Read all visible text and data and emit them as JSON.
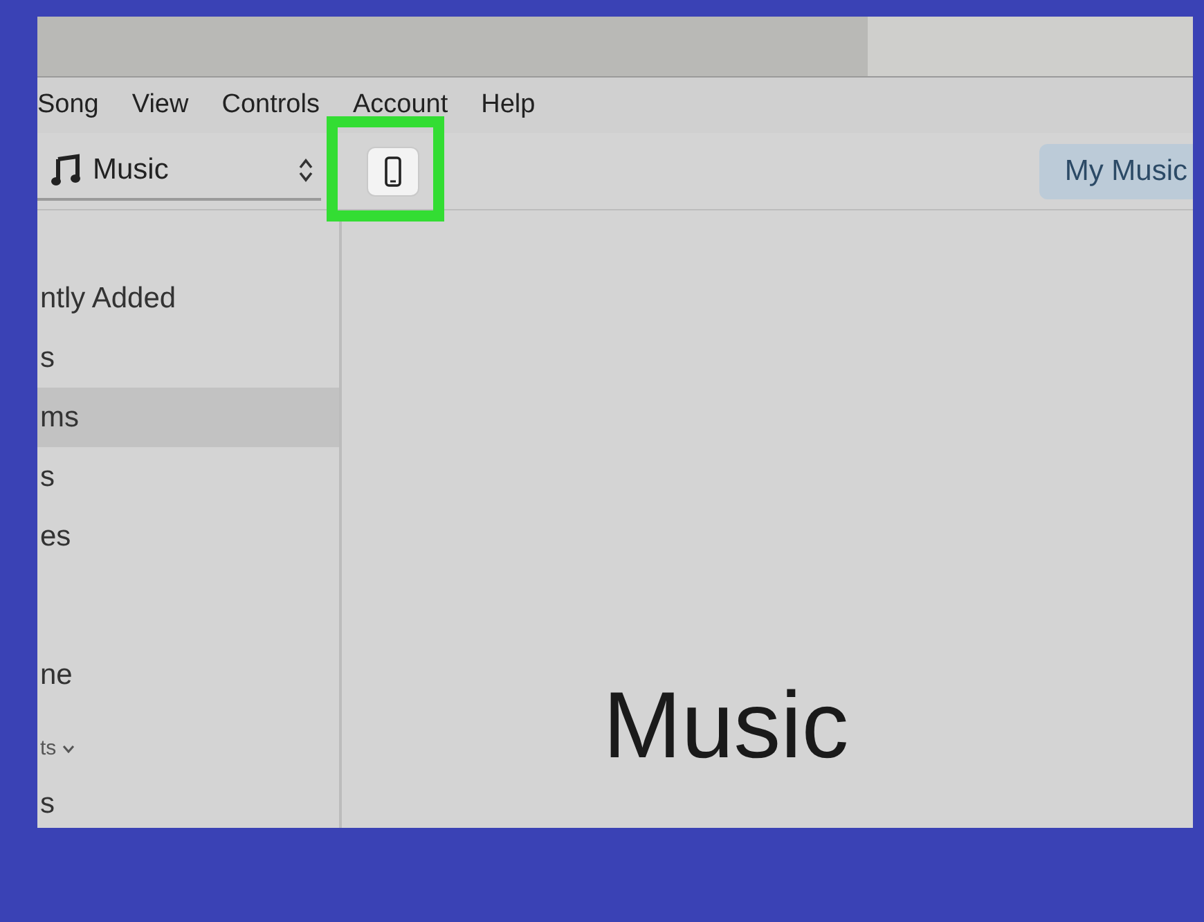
{
  "menu_bar": [
    "Song",
    "View",
    "Controls",
    "Account",
    "Help"
  ],
  "toolbar": {
    "media_picker": {
      "label": "Music"
    },
    "tabs": [
      {
        "label": "My Music",
        "selected": true
      }
    ]
  },
  "sidebar": {
    "sections": [
      {
        "items": [
          {
            "label": "ntly Added",
            "selected": false
          },
          {
            "label": "s",
            "selected": false
          },
          {
            "label": "ms",
            "selected": true
          },
          {
            "label": "s",
            "selected": false
          },
          {
            "label": "es",
            "selected": false
          }
        ]
      },
      {
        "items": [
          {
            "label": "ne",
            "selected": false
          }
        ]
      },
      {
        "header": "ts",
        "items": [
          {
            "label": "s",
            "selected": false
          }
        ]
      }
    ]
  },
  "main": {
    "heading": "Music"
  }
}
